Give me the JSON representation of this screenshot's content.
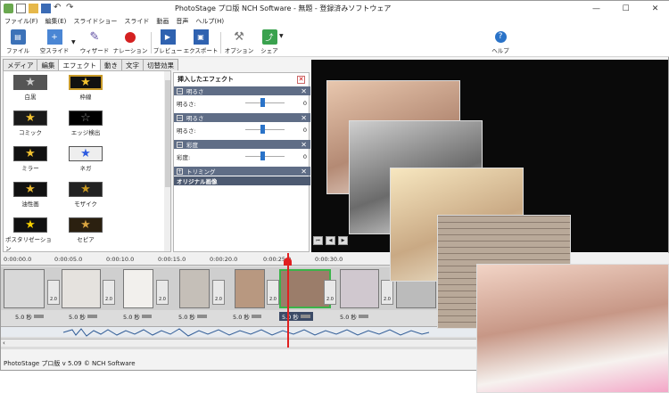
{
  "app": {
    "title": "PhotoStage プロ版 NCH Software - 無題 - 登録済みソフトウェア",
    "window_min": "—",
    "window_max": "☐",
    "window_close": "✕"
  },
  "menu": [
    "ファイル(F)",
    "編集(E)",
    "スライドショー",
    "スライド",
    "動画",
    "音声",
    "ヘルプ(H)"
  ],
  "toolbar": {
    "file": "ファイル",
    "add_slide": "空スライド",
    "wizard": "ウィザード",
    "narration": "ナレーション",
    "preview": "プレビュー",
    "export": "エクスポート",
    "options": "オプション",
    "share": "シェア",
    "help": "ヘルプ"
  },
  "tabs": [
    "メディア",
    "編集",
    "エフェクト",
    "動き",
    "文字",
    "切替効果"
  ],
  "active_tab": "エフェクト",
  "effects": [
    "白黒",
    "枠線",
    "コミック",
    "エッジ検出",
    "ミラー",
    "ネガ",
    "油性画",
    "モザイク",
    "ポスタリゼーション",
    "セピア"
  ],
  "inserted_effects": {
    "header": "挿入したエフェクト",
    "sections": [
      {
        "name": "明るさ",
        "row_label": "明るさ:",
        "value": "0"
      },
      {
        "name": "明るさ",
        "row_label": "明るさ:",
        "value": "0"
      },
      {
        "name": "彩度",
        "row_label": "彩度:",
        "value": "0"
      },
      {
        "name": "トリミング"
      }
    ],
    "original": "オリジナル画像"
  },
  "ruler": [
    "0:00:00.0",
    "0:00:05.0",
    "0:00:10.0",
    "0:00:15.0",
    "0:00:20.0",
    "0:00:25.0",
    "0:00:30.0"
  ],
  "transition_value": "2.0",
  "durations": [
    "5.0 秒",
    "5.0 秒",
    "5.0 秒",
    "5.0 秒",
    "5.0 秒",
    "5.0 秒",
    "5.0 秒"
  ],
  "status": "PhotoStage プロ版 v 5.09 © NCH Software",
  "colors": {
    "accent": "#5f6d86",
    "playhead": "#e02020",
    "star": "#f2c230",
    "negative_star": "#2d5be0"
  }
}
